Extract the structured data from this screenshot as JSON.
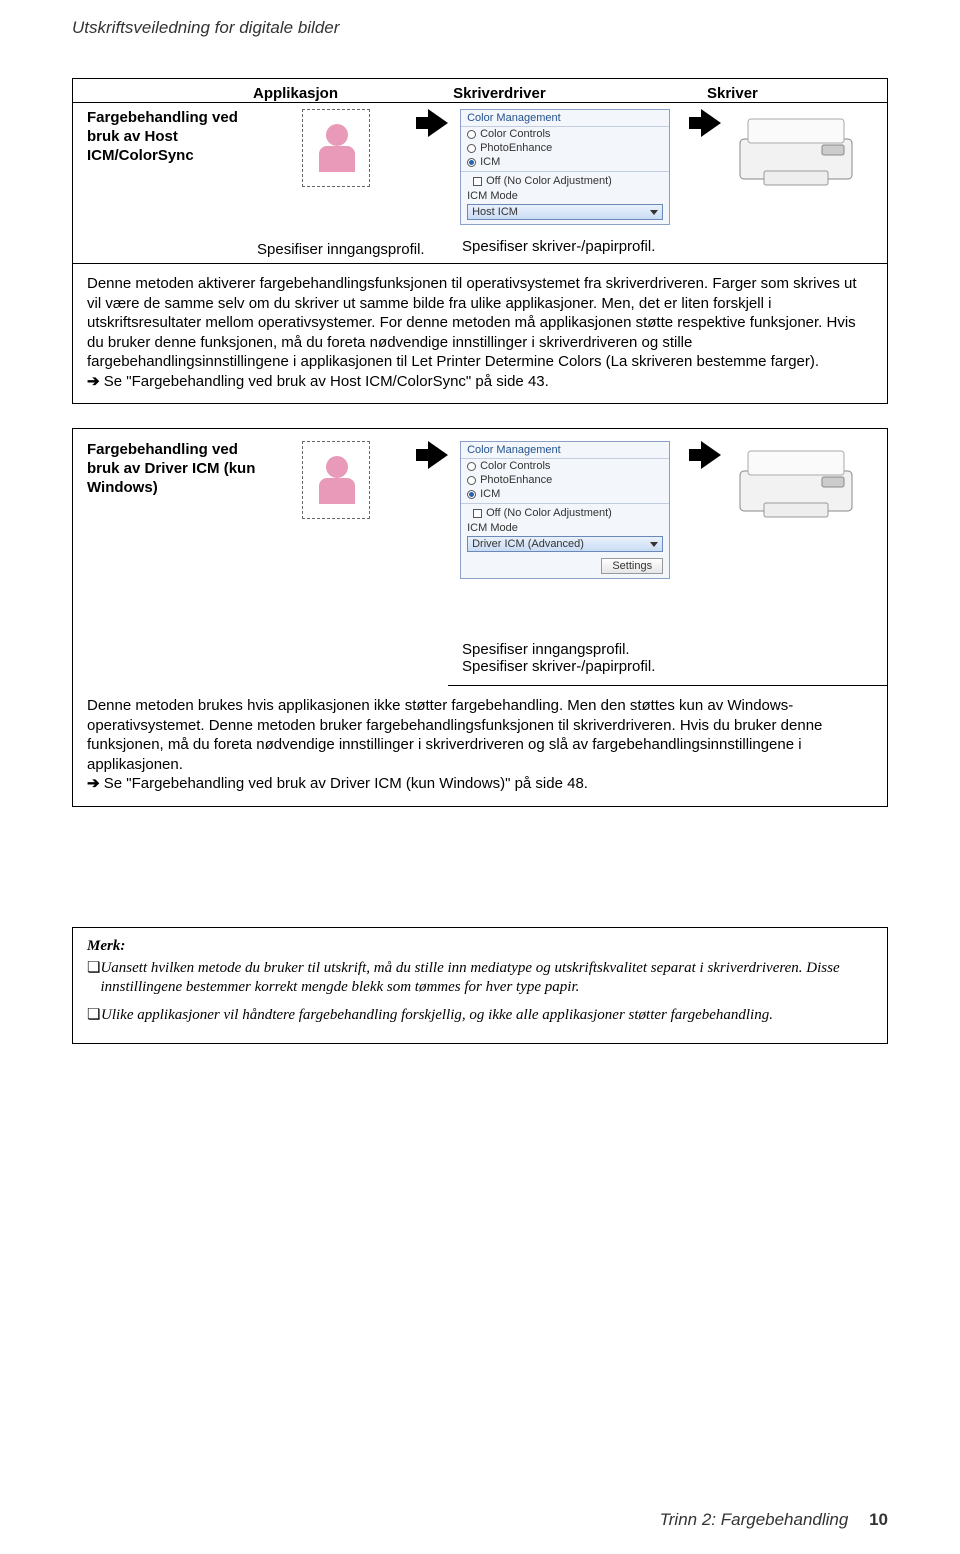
{
  "header": {
    "doc_title": "Utskriftsveiledning for digitale bilder"
  },
  "table1": {
    "h_app": "Applikasjon",
    "h_driver": "Skriverdriver",
    "h_printer": "Skriver",
    "row_label": "Fargebehandling ved bruk av Host ICM/ColorSync",
    "spec_input": "Spesifiser inngangsprofil.",
    "spec_output": "Spesifiser skriver-/papirprofil.",
    "driver": {
      "title": "Color Management",
      "o1": "Color Controls",
      "o2": "PhotoEnhance",
      "o3": "ICM",
      "off": "Off (No Color Adjustment)",
      "mode_label": "ICM Mode",
      "mode_value": "Host ICM"
    },
    "desc": "Denne metoden aktiverer fargebehandlingsfunksjonen til operativsystemet fra skriverdriveren. Farger som skrives ut vil være de samme selv om du skriver ut samme bilde fra ulike applikasjoner. Men, det er liten forskjell i utskriftsresultater mellom operativsystemer. For denne metoden må applikasjonen støtte respektive funksjoner. Hvis du bruker denne funksjonen, må du foreta nødvendige innstillinger i skriverdriveren og stille fargebehandlingsinnstillingene i applikasjonen til Let Printer Determine Colors (La skriveren bestemme farger).",
    "link": "Se \"Fargebehandling ved bruk av Host ICM/ColorSync\" på side 43."
  },
  "table2": {
    "row_label": "Fargebehandling ved bruk av Driver ICM (kun Windows)",
    "driver": {
      "title": "Color Management",
      "o1": "Color Controls",
      "o2": "PhotoEnhance",
      "o3": "ICM",
      "off": "Off (No Color Adjustment)",
      "mode_label": "ICM Mode",
      "mode_value": "Driver ICM (Advanced)",
      "settings": "Settings"
    },
    "spec_input": "Spesifiser inngangsprofil.",
    "spec_output": "Spesifiser skriver-/papirprofil.",
    "desc": "Denne metoden brukes hvis applikasjonen ikke støtter fargebehandling. Men den støttes kun av Windows-operativsystemet. Denne metoden bruker fargebehandlingsfunksjonen til skriverdriveren. Hvis du bruker denne funksjonen, må du foreta nødvendige innstillinger i skriverdriveren og slå av fargebehandlingsinnstillingene i applikasjonen.",
    "link": "Se \"Fargebehandling ved bruk av Driver ICM (kun Windows)\" på side 48."
  },
  "note": {
    "title": "Merk:",
    "item1": "Uansett hvilken metode du bruker til utskrift, må du stille inn mediatype og utskriftskvalitet separat i skriverdriveren. Disse innstillingene bestemmer korrekt mengde blekk som tømmes for hver type papir.",
    "item2": "Ulike applikasjoner vil håndtere fargebehandling forskjellig, og ikke alle applikasjoner støtter fargebehandling."
  },
  "footer": {
    "section": "Trinn 2: Fargebehandling",
    "page": "10"
  }
}
